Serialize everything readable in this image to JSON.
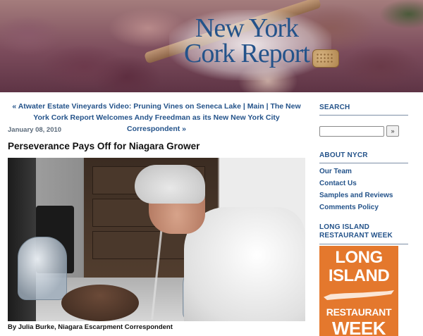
{
  "header": {
    "title_line1": "New York",
    "title_line2": "Cork Report"
  },
  "nav": {
    "prev_link": "« Atwater Estate Vineyards Video: Pruning Vines on Seneca Lake",
    "separator1": " | ",
    "main_link": "Main",
    "separator2": " | ",
    "next_link": "The New York Cork Report Welcomes Andy Freedman as its New New York City Correspondent »"
  },
  "post": {
    "date": "January 08, 2010",
    "title": "Perseverance Pays Off for Niagara Grower",
    "byline": "By Julia Burke, Niagara Escarpment Correspondent"
  },
  "sidebar": {
    "search_heading": "SEARCH",
    "search_placeholder": "",
    "search_button": "»",
    "about_heading": "ABOUT NYCR",
    "about_links": [
      "Our Team",
      "Contact Us",
      "Samples and Reviews",
      "Comments Policy"
    ],
    "lirw_heading": "LONG ISLAND RESTAURANT WEEK",
    "lirw_badge": {
      "line1": "LONG",
      "line2": "ISLAND",
      "line3": "RESTAURANT",
      "line4": "WEEK"
    }
  },
  "colors": {
    "link_blue": "#24538a",
    "badge_orange": "#e4782d"
  }
}
